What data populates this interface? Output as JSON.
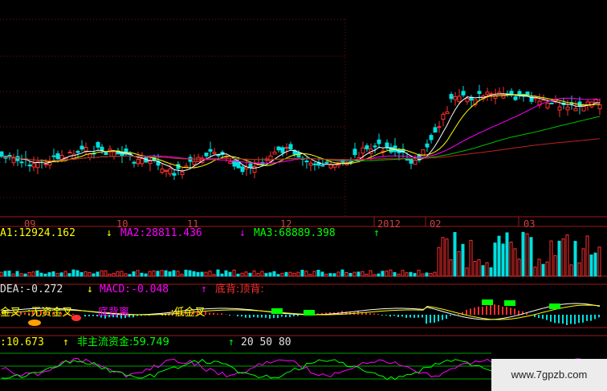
{
  "chart_data": {
    "type": "candlestick",
    "x_ticks": [
      "09",
      "10",
      "11",
      "12",
      "2012",
      "02",
      "03"
    ],
    "panels": {
      "volume": {
        "labels": [
          {
            "text": "A1:12924.162",
            "color": "#ffff00"
          },
          {
            "text": "↓",
            "color": "#ffff00"
          },
          {
            "text": "MA2:28811.436",
            "color": "#ff00ff"
          },
          {
            "text": "↓",
            "color": "#ff00ff"
          },
          {
            "text": "MA3:68889.398",
            "color": "#00ff00"
          },
          {
            "text": "↑",
            "color": "#00ff00"
          }
        ]
      },
      "macd": {
        "labels": [
          {
            "text": "DEA:-0.272",
            "color": "#e0e0e0"
          },
          {
            "text": "↓",
            "color": "#ffff00"
          },
          {
            "text": "MACD:-0.048",
            "color": "#ff00ff"
          },
          {
            "text": "↑",
            "color": "#ff00ff"
          },
          {
            "text": "底背:顶背:",
            "color": "#ff3030"
          }
        ],
        "overlay_text": [
          {
            "text": "金叉",
            "color": "#ffff00"
          },
          {
            "text": ":无资金叉",
            "color": "#ffff00"
          },
          {
            "text": "底背离",
            "color": "#ff00ff"
          },
          {
            "text": "...:低金叉",
            "color": "#ffff00"
          }
        ]
      },
      "funds": {
        "labels": [
          {
            "text": ":10.673",
            "color": "#ffff00"
          },
          {
            "text": "↑",
            "color": "#ffff00"
          },
          {
            "text": "非主流资金:59.749",
            "color": "#00ff00"
          },
          {
            "text": "↑",
            "color": "#00ff00"
          },
          {
            "text": "20 50 80",
            "color": "#e0e0e0"
          }
        ]
      }
    },
    "watermark": "www.7gpzb.com"
  }
}
